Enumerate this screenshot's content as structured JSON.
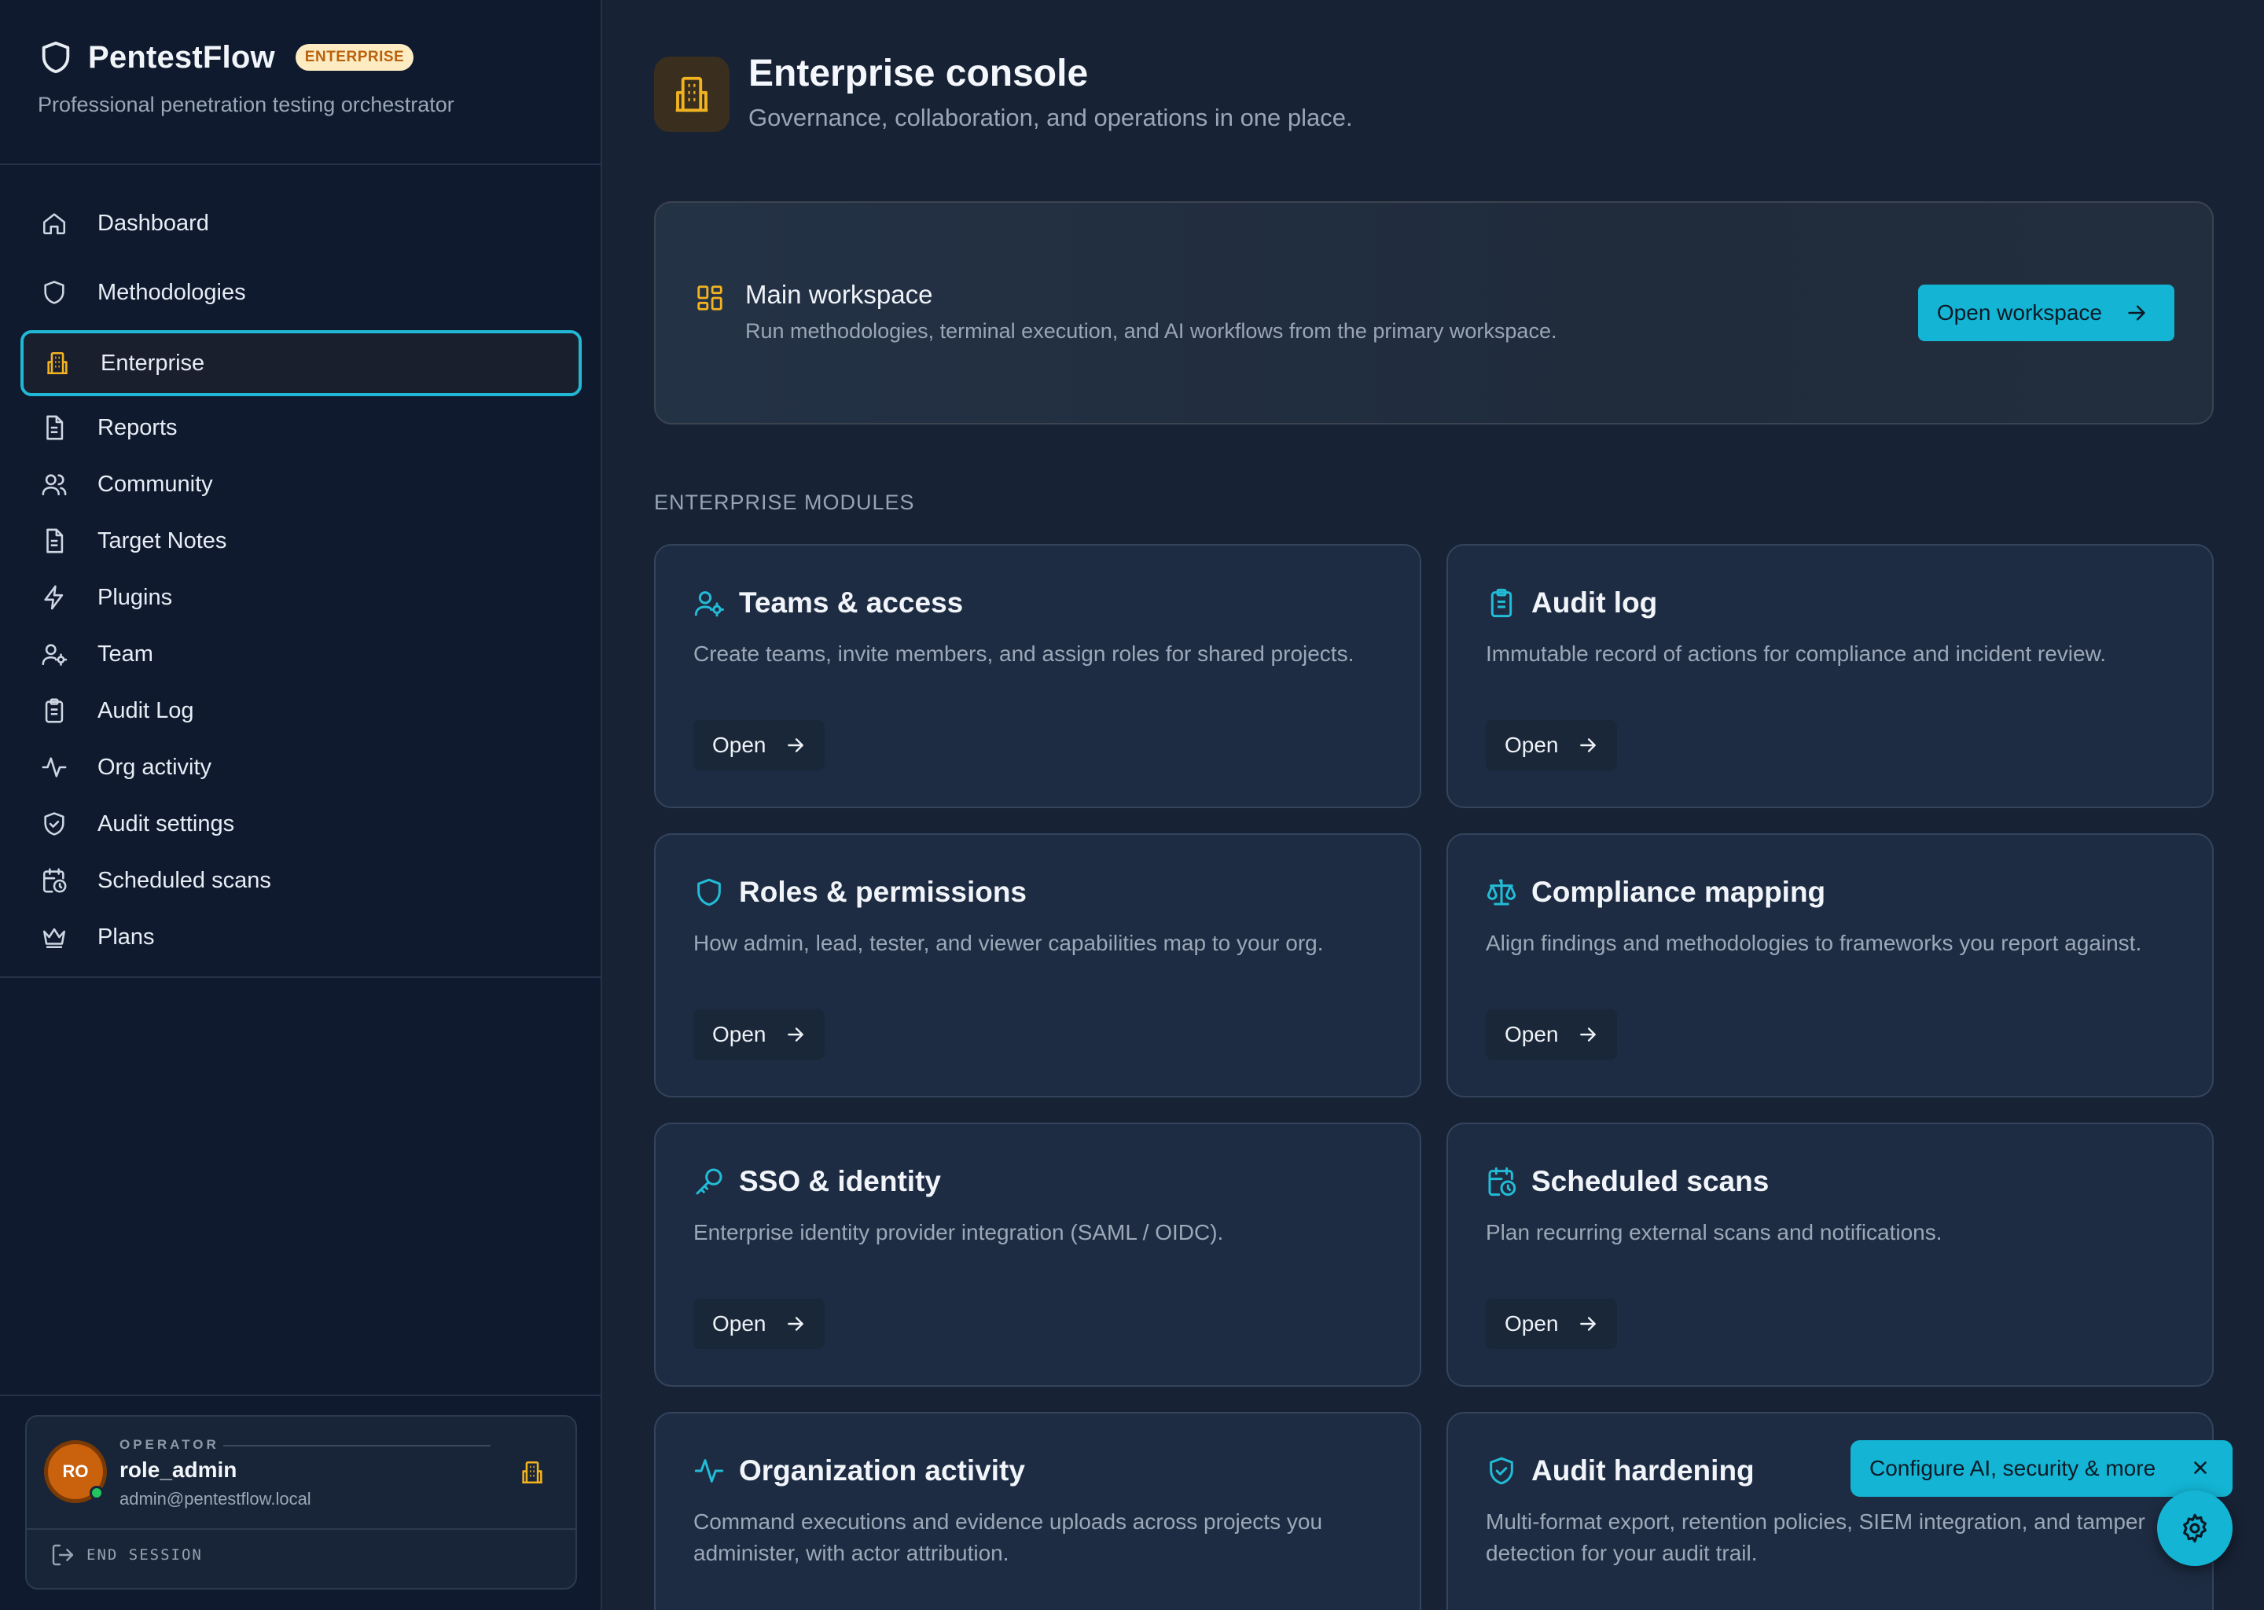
{
  "brand": {
    "name": "PentestFlow",
    "badge": "ENTERPRISE",
    "subtitle": "Professional penetration testing orchestrator"
  },
  "nav": {
    "items": [
      {
        "label": "Dashboard",
        "icon": "home-icon"
      },
      {
        "label": "Methodologies",
        "icon": "shield-icon"
      },
      {
        "label": "Enterprise",
        "icon": "building-icon",
        "active": true
      },
      {
        "label": "Reports",
        "icon": "document-icon"
      },
      {
        "label": "Community",
        "icon": "users-icon"
      },
      {
        "label": "Target Notes",
        "icon": "document-icon"
      },
      {
        "label": "Plugins",
        "icon": "bolt-icon"
      },
      {
        "label": "Team",
        "icon": "user-gear-icon"
      },
      {
        "label": "Audit Log",
        "icon": "clipboard-icon"
      },
      {
        "label": "Org activity",
        "icon": "activity-icon"
      },
      {
        "label": "Audit settings",
        "icon": "shield-check-icon"
      },
      {
        "label": "Scheduled scans",
        "icon": "calendar-clock-icon"
      },
      {
        "label": "Plans",
        "icon": "crown-icon"
      }
    ]
  },
  "user": {
    "initials": "RO",
    "role_label": "OPERATOR",
    "name": "role_admin",
    "email": "admin@pentestflow.local",
    "end_session": "END SESSION"
  },
  "page": {
    "title": "Enterprise console",
    "subtitle": "Governance, collaboration, and operations in one place."
  },
  "workspace": {
    "title": "Main workspace",
    "description": "Run methodologies, terminal execution, and AI workflows from the primary workspace.",
    "button": "Open workspace"
  },
  "modules": {
    "section_label": "ENTERPRISE MODULES",
    "open_label": "Open",
    "items": [
      {
        "title": "Teams & access",
        "description": "Create teams, invite members, and assign roles for shared projects.",
        "icon": "user-gear-icon"
      },
      {
        "title": "Audit log",
        "description": "Immutable record of actions for compliance and incident review.",
        "icon": "clipboard-icon"
      },
      {
        "title": "Roles & permissions",
        "description": "How admin, lead, tester, and viewer capabilities map to your org.",
        "icon": "shield-icon"
      },
      {
        "title": "Compliance mapping",
        "description": "Align findings and methodologies to frameworks you report against.",
        "icon": "scale-icon"
      },
      {
        "title": "SSO & identity",
        "description": "Enterprise identity provider integration (SAML / OIDC).",
        "icon": "key-icon"
      },
      {
        "title": "Scheduled scans",
        "description": "Plan recurring external scans and notifications.",
        "icon": "calendar-clock-icon"
      },
      {
        "title": "Organization activity",
        "description": "Command executions and evidence uploads across projects you administer, with actor attribution.",
        "icon": "activity-icon"
      },
      {
        "title": "Audit hardening",
        "description": "Multi-format export, retention policies, SIEM integration, and tamper detection for your audit trail.",
        "icon": "shield-check-icon"
      }
    ]
  },
  "toast": {
    "text": "Configure AI, security & more"
  },
  "colors": {
    "accent": "#13b4d4",
    "amber": "#f2b321",
    "sidebar_bg": "#0f1a2e",
    "main_bg": "#172235",
    "card_bg": "#1e2c43"
  }
}
